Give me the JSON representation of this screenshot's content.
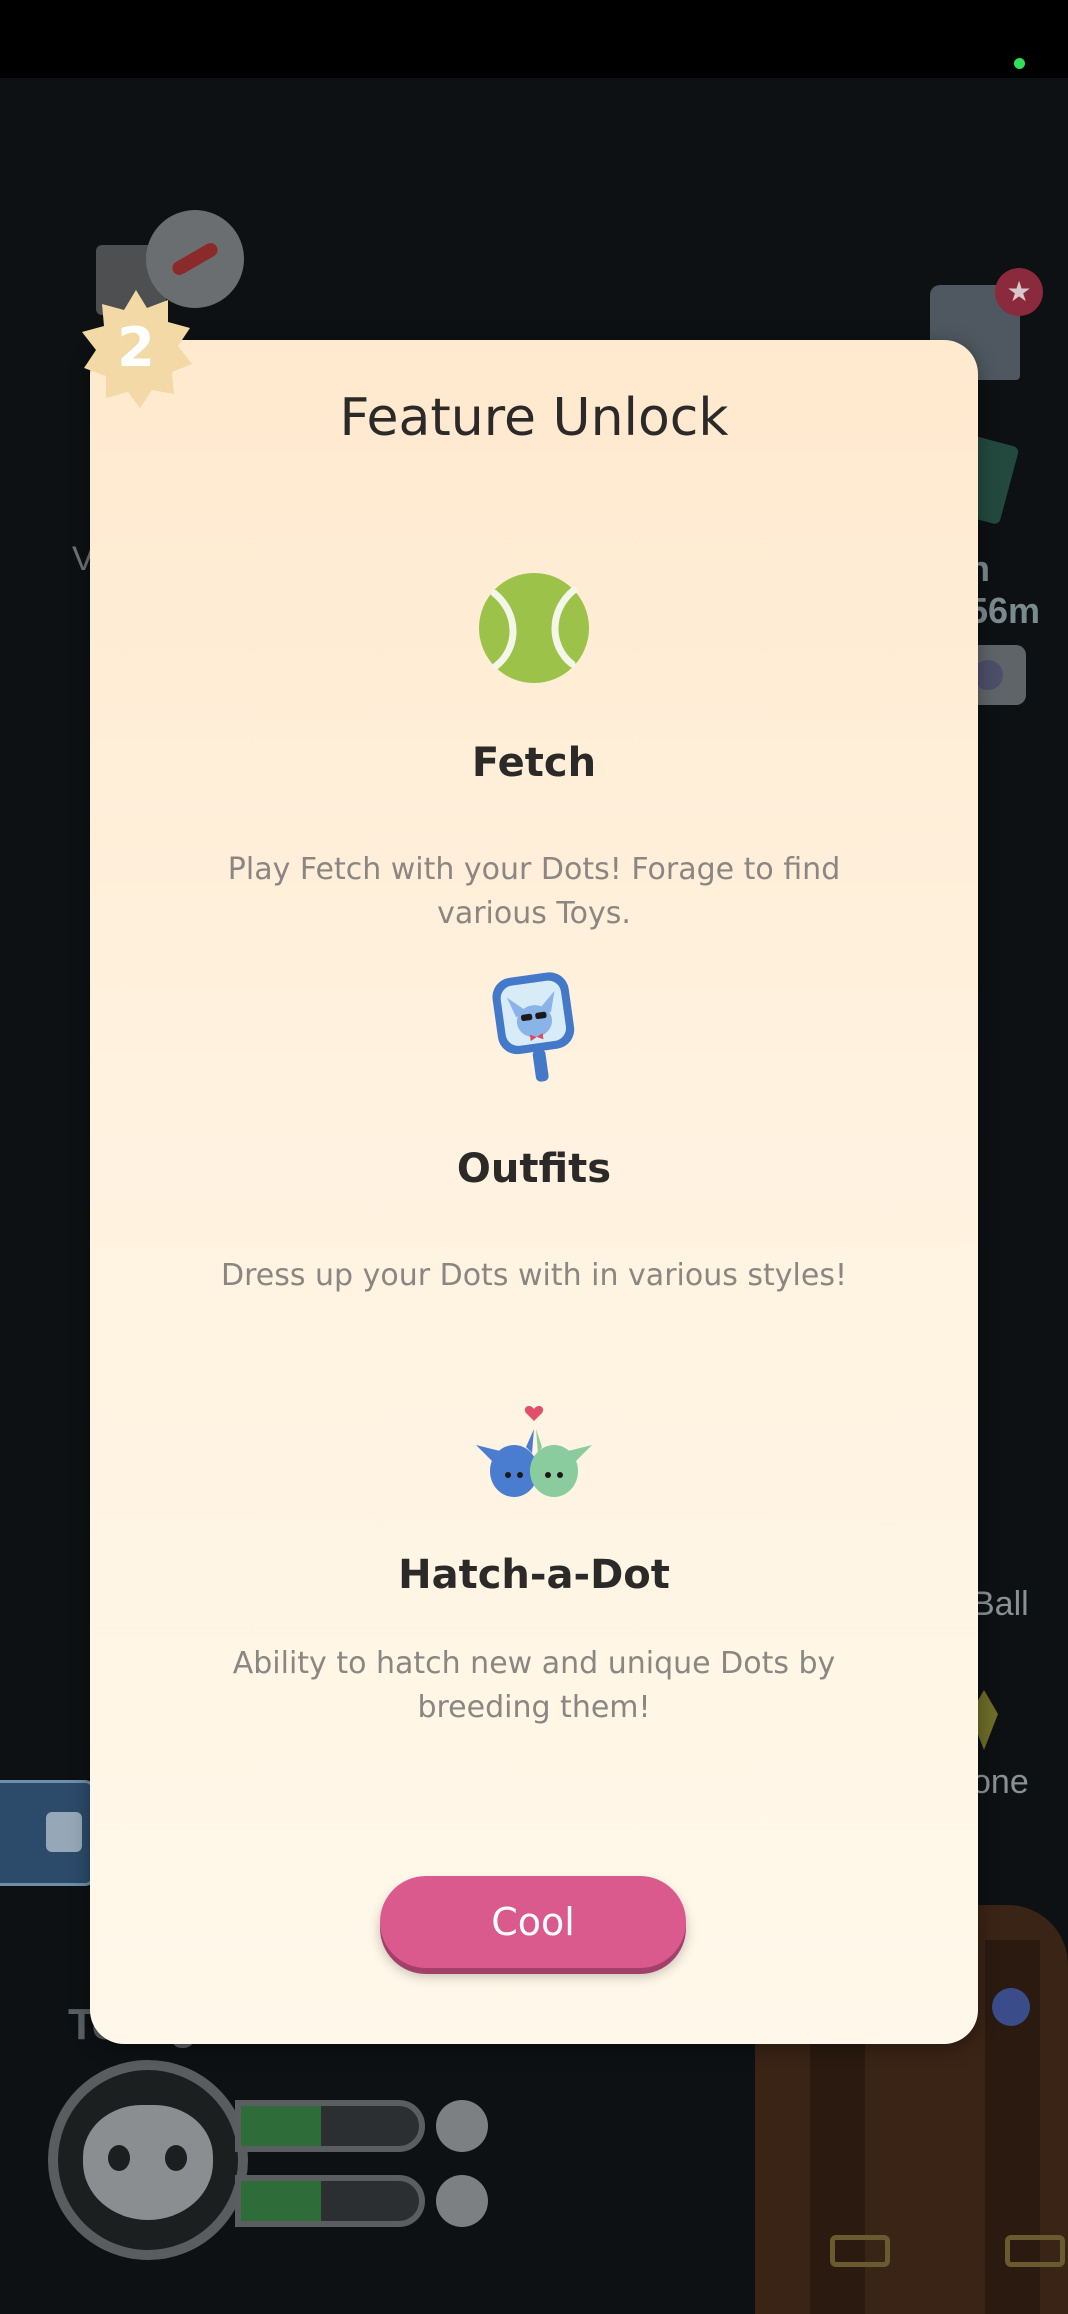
{
  "background": {
    "timer_text": "n 56m",
    "ball_text": "Ball",
    "one_text": "one",
    "left_partial_text": "V",
    "left_label_text": "To..ng",
    "food_bar_fill": 0.45,
    "toy_bar_fill": 0.45
  },
  "modal": {
    "level_badge": "2",
    "title": "Feature Unlock",
    "features": [
      {
        "icon": "tennis-ball-icon",
        "name": "Fetch",
        "description": "Play Fetch with your Dots! Forage to find various Toys."
      },
      {
        "icon": "mirror-outfit-icon",
        "name": "Outfits",
        "description": "Dress up your Dots with in various styles!"
      },
      {
        "icon": "hatch-dots-icon",
        "name": "Hatch-a-Dot",
        "description": "Ability to hatch new and unique Dots by breeding them!"
      }
    ],
    "button_label": "Cool"
  },
  "colors": {
    "button": "#db5a8e",
    "badge": "#f2d9a6",
    "ball": "#9cc24a",
    "mirror_frame": "#4478c8"
  }
}
